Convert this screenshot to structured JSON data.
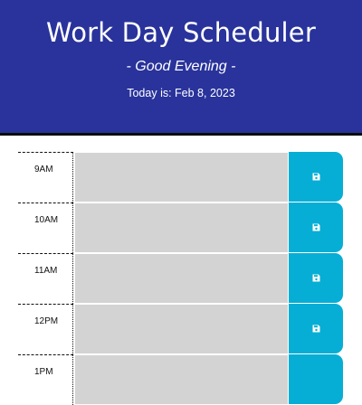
{
  "header": {
    "title": "Work Day Scheduler",
    "greeting": "- Good Evening -",
    "today_label": "Today is: ",
    "today_date": "Feb 8, 2023"
  },
  "rows": [
    {
      "hour": "9AM",
      "description": ""
    },
    {
      "hour": "10AM",
      "description": ""
    },
    {
      "hour": "11AM",
      "description": ""
    },
    {
      "hour": "12PM",
      "description": ""
    },
    {
      "hour": "1PM",
      "description": ""
    }
  ],
  "icons": {
    "save": "floppy-disk-icon"
  },
  "colors": {
    "header_bg": "#29339b",
    "past_row": "#d3d3d3",
    "save_button": "#06aed5"
  }
}
